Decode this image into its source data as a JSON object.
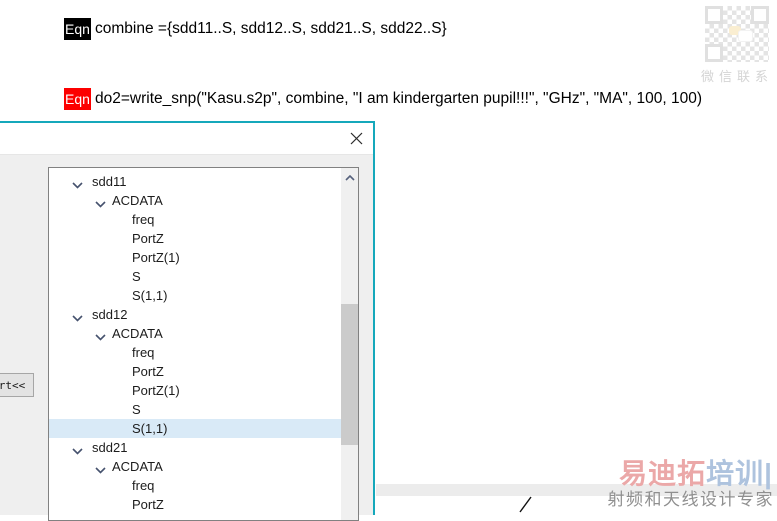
{
  "equations": [
    {
      "badge": "Eqn",
      "text": "combine ={sdd11..S, sdd12..S, sdd21..S, sdd22..S}"
    },
    {
      "badge": "Eqn",
      "text": "do2=write_snp(\"Kasu.s2p\", combine, \"I am kindergarten pupil!!!\", \"GHz\", \"MA\", 100, 100)"
    }
  ],
  "colors": {
    "eqn1_badge": "#000000",
    "eqn2_badge": "#fc0000",
    "dialog_border": "#15a8bb",
    "tree_selection": "#d9eaf7"
  },
  "icons": {
    "close": "x-cross",
    "chevron_expanded": "chevron-down",
    "scroll_up": "chevron-up"
  },
  "dialog": {
    "partial_button_label": "rt<<",
    "tree_rows": [
      {
        "label": "sdd11",
        "level": 0,
        "expanded": true,
        "selected": false
      },
      {
        "label": "ACDATA",
        "level": 1,
        "expanded": true,
        "selected": false
      },
      {
        "label": "freq",
        "level": 2,
        "expanded": false,
        "selected": false
      },
      {
        "label": "PortZ",
        "level": 2,
        "expanded": false,
        "selected": false
      },
      {
        "label": "PortZ(1)",
        "level": 2,
        "expanded": false,
        "selected": false
      },
      {
        "label": "S",
        "level": 2,
        "expanded": false,
        "selected": false
      },
      {
        "label": "S(1,1)",
        "level": 2,
        "expanded": false,
        "selected": false
      },
      {
        "label": "sdd12",
        "level": 0,
        "expanded": true,
        "selected": false
      },
      {
        "label": "ACDATA",
        "level": 1,
        "expanded": true,
        "selected": false
      },
      {
        "label": "freq",
        "level": 2,
        "expanded": false,
        "selected": false
      },
      {
        "label": "PortZ",
        "level": 2,
        "expanded": false,
        "selected": false
      },
      {
        "label": "PortZ(1)",
        "level": 2,
        "expanded": false,
        "selected": false
      },
      {
        "label": "S",
        "level": 2,
        "expanded": false,
        "selected": false
      },
      {
        "label": "S(1,1)",
        "level": 2,
        "expanded": false,
        "selected": true
      },
      {
        "label": "sdd21",
        "level": 0,
        "expanded": true,
        "selected": false
      },
      {
        "label": "ACDATA",
        "level": 1,
        "expanded": true,
        "selected": false
      },
      {
        "label": "freq",
        "level": 2,
        "expanded": false,
        "selected": false
      },
      {
        "label": "PortZ",
        "level": 2,
        "expanded": false,
        "selected": false
      }
    ]
  },
  "watermark": {
    "qr_caption": "微信联系",
    "logo_part1": "易迪拓",
    "logo_part2": "培训",
    "logo_bar": "|",
    "logo_subtitle": "射频和天线设计专家"
  }
}
